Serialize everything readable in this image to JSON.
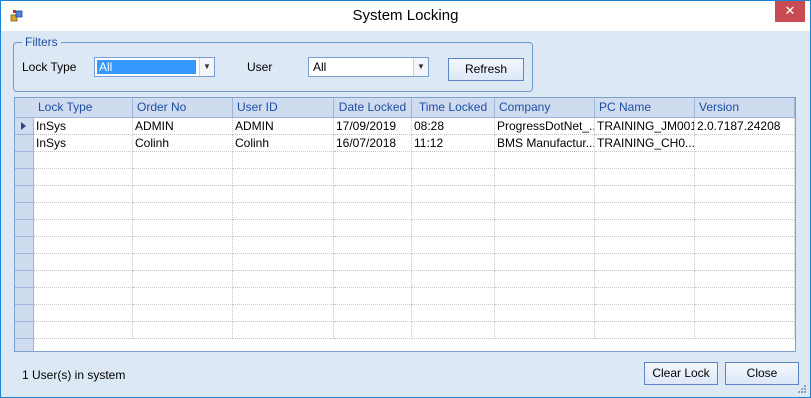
{
  "window": {
    "title": "System Locking",
    "close_glyph": "✕"
  },
  "filters": {
    "legend": "Filters",
    "lock_type_label": "Lock Type",
    "lock_type_value": "All",
    "user_label": "User",
    "user_value": "All",
    "refresh_label": "Refresh"
  },
  "grid": {
    "columns": [
      "Lock Type",
      "Order No",
      "User ID",
      "Date Locked",
      "Time Locked",
      "Company",
      "PC Name",
      "Version"
    ],
    "rows": [
      [
        "InSys",
        "ADMIN",
        "ADMIN",
        "17/09/2019",
        "08:28",
        "ProgressDotNet_...",
        "TRAINING_JM001",
        "2.0.7187.24208"
      ],
      [
        "InSys",
        "Colinh",
        "Colinh",
        "16/07/2018",
        "11:12",
        "BMS Manufactur...",
        "TRAINING_CH0...",
        ""
      ]
    ]
  },
  "footer": {
    "status": "1 User(s) in system",
    "clear_lock_label": "Clear Lock",
    "close_label": "Close"
  },
  "colors": {
    "accent": "#1883d7",
    "header_text": "#1d4fa3",
    "selection": "#3399ff",
    "close_button": "#c74b50"
  }
}
